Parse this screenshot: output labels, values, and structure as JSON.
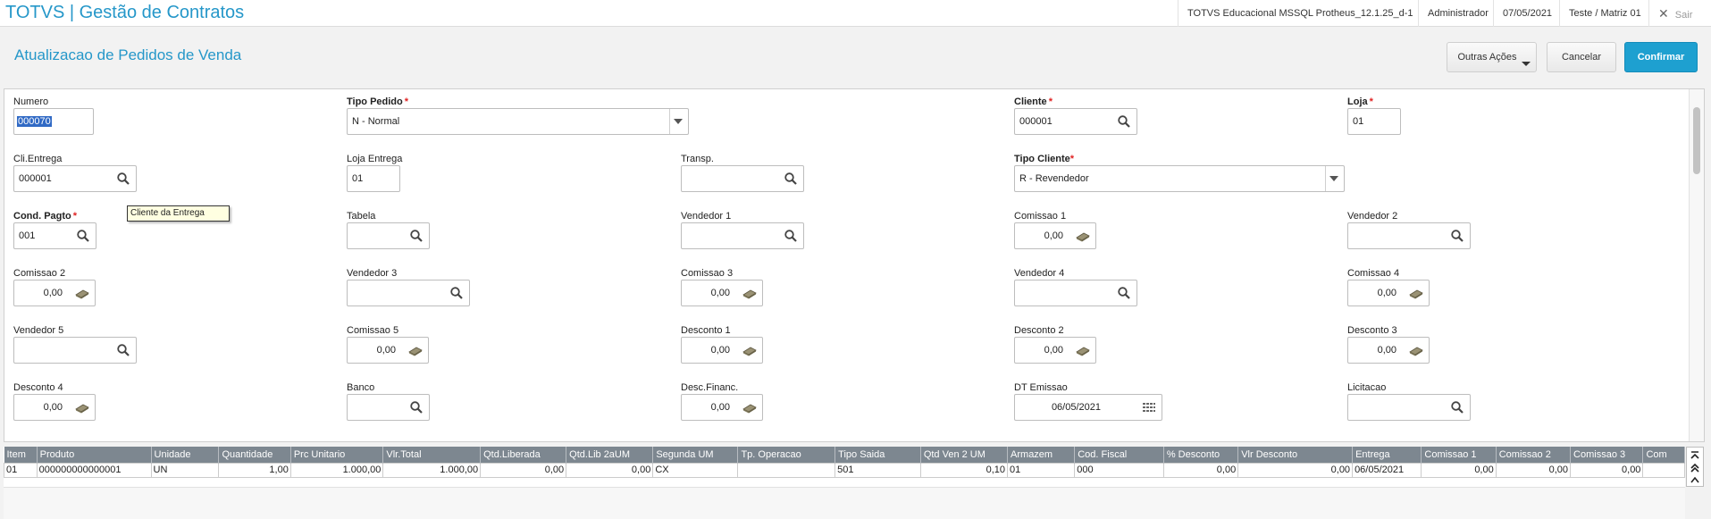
{
  "topbar": {
    "app_title": "TOTVS | Gestão de Contratos",
    "environment": "TOTVS Educacional MSSQL Protheus_12.1.25_d-1",
    "user": "Administrador",
    "date": "07/05/2021",
    "branch": "Teste / Matriz 01",
    "exit_label": "Sair"
  },
  "header": {
    "title": "Atualizacao de Pedidos de Venda",
    "outras_acoes": "Outras Ações",
    "cancelar": "Cancelar",
    "confirmar": "Confirmar"
  },
  "fields": {
    "numero": {
      "label": "Numero",
      "value": "000070"
    },
    "tipo_pedido": {
      "label": "Tipo Pedido",
      "value": "N - Normal"
    },
    "cliente": {
      "label": "Cliente",
      "value": "000001"
    },
    "loja": {
      "label": "Loja",
      "value": "01"
    },
    "cli_entrega": {
      "label": "Cli.Entrega",
      "value": "000001"
    },
    "loja_entrega": {
      "label": "Loja Entrega",
      "value": "01"
    },
    "transp": {
      "label": "Transp.",
      "value": ""
    },
    "tipo_cliente": {
      "label": "Tipo Cliente",
      "value": "R - Revendedor"
    },
    "cond_pagto": {
      "label": "Cond. Pagto",
      "value": "001"
    },
    "tabela": {
      "label": "Tabela",
      "value": ""
    },
    "vendedor1": {
      "label": "Vendedor 1",
      "value": ""
    },
    "comissao1": {
      "label": "Comissao 1",
      "value": "0,00"
    },
    "vendedor2": {
      "label": "Vendedor 2",
      "value": ""
    },
    "comissao2": {
      "label": "Comissao 2",
      "value": "0,00"
    },
    "vendedor3": {
      "label": "Vendedor 3",
      "value": ""
    },
    "comissao3": {
      "label": "Comissao 3",
      "value": "0,00"
    },
    "vendedor4": {
      "label": "Vendedor 4",
      "value": ""
    },
    "comissao4": {
      "label": "Comissao 4",
      "value": "0,00"
    },
    "vendedor5": {
      "label": "Vendedor 5",
      "value": ""
    },
    "comissao5": {
      "label": "Comissao 5",
      "value": "0,00"
    },
    "desconto1": {
      "label": "Desconto 1",
      "value": "0,00"
    },
    "desconto2": {
      "label": "Desconto 2",
      "value": "0,00"
    },
    "desconto3": {
      "label": "Desconto 3",
      "value": "0,00"
    },
    "desconto4": {
      "label": "Desconto 4",
      "value": "0,00"
    },
    "banco": {
      "label": "Banco",
      "value": ""
    },
    "desc_financ": {
      "label": "Desc.Financ.",
      "value": "0,00"
    },
    "dt_emissao": {
      "label": "DT Emissao",
      "value": "06/05/2021"
    },
    "licitacao": {
      "label": "Licitacao",
      "value": ""
    }
  },
  "tooltip": "Cliente da Entrega",
  "grid": {
    "headers": [
      "Item",
      "Produto",
      "Unidade",
      "Quantidade",
      "Prc Unitario",
      "Vlr.Total",
      "Qtd.Liberada",
      "Qtd.Lib 2aUM",
      "Segunda UM",
      "Tp. Operacao",
      "Tipo Saida",
      "Qtd Ven 2 UM",
      "Armazem",
      "Cod. Fiscal",
      "% Desconto",
      "Vlr Desconto",
      "Entrega",
      "Comissao 1",
      "Comissao 2",
      "Comissao 3",
      "Com"
    ],
    "row": [
      "01",
      "000000000000001",
      "UN",
      "1,00",
      "1.000,00",
      "1.000,00",
      "0,00",
      "0,00",
      "CX",
      "",
      "501",
      "0,10",
      "01",
      "000",
      "0,00",
      "0,00",
      "06/05/2021",
      "0,00",
      "0,00",
      "0,00",
      ""
    ]
  }
}
